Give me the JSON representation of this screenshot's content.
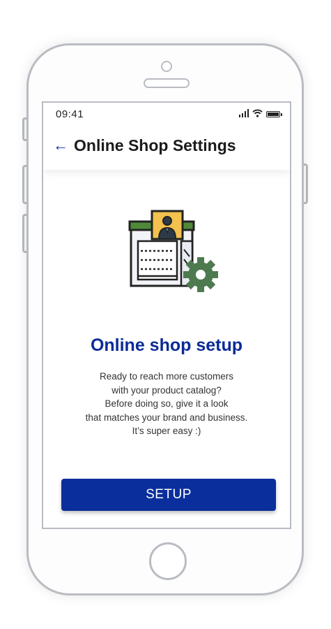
{
  "status_bar": {
    "time": "09:41"
  },
  "header": {
    "back_icon": "arrow-left-icon",
    "title": "Online Shop Settings"
  },
  "illustration": {
    "name": "storefront-with-gear-icon"
  },
  "main": {
    "heading": "Online shop setup",
    "description_lines": [
      "Ready to reach more customers",
      "with your product catalog?",
      "Before doing so, give it a look",
      "that matches your brand and business.",
      "It’s super easy :)"
    ]
  },
  "actions": {
    "setup_label": "SETUP"
  },
  "colors": {
    "accent": "#0a2e9c",
    "store_roof": "#4f8a3a",
    "gear": "#4e7a50",
    "badge": "#f2c14e"
  }
}
